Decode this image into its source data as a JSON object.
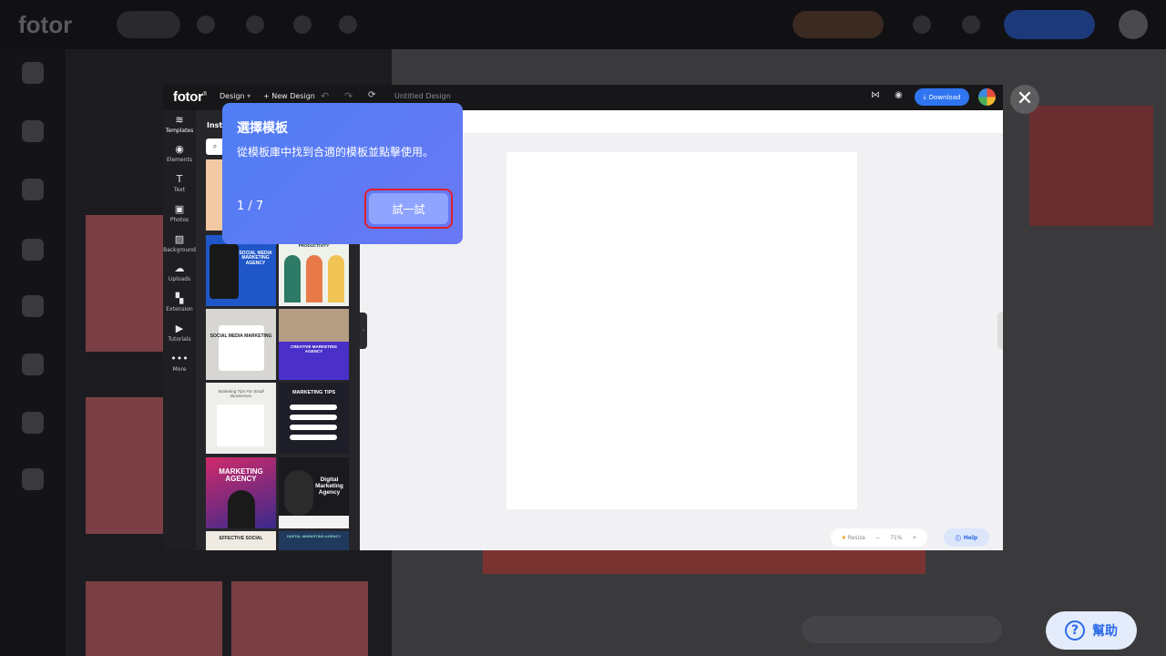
{
  "editor": {
    "logo": "fotor",
    "menu_design": "Design",
    "menu_new_design": "New Design",
    "doc_title": "Untitled Design",
    "download_label": "Download",
    "panel_title": "Insta",
    "rail": [
      {
        "label": "Templates",
        "icon": "layers-icon",
        "glyph": "≋"
      },
      {
        "label": "Elements",
        "icon": "elements-icon",
        "glyph": "◉"
      },
      {
        "label": "Text",
        "icon": "text-icon",
        "glyph": "T"
      },
      {
        "label": "Photos",
        "icon": "photo-icon",
        "glyph": "▣"
      },
      {
        "label": "Background",
        "icon": "background-icon",
        "glyph": "▨"
      },
      {
        "label": "Uploads",
        "icon": "upload-icon",
        "glyph": "☁"
      },
      {
        "label": "Extension",
        "icon": "extension-icon",
        "glyph": "▚"
      },
      {
        "label": "Tutorials",
        "icon": "tutorial-icon",
        "glyph": "▶"
      },
      {
        "label": "More",
        "icon": "more-icon",
        "glyph": "•••"
      }
    ],
    "templates": [
      {
        "text": "SOCIAL MEDIA MARKETING AGENCY"
      },
      {
        "text": "3 STEPS TO INCREASE YOUR PRODUCTIVITY"
      },
      {
        "text": "SOCIAL MEDIA MARKETING"
      },
      {
        "text": "CREATIVE MARKETING AGENCY"
      },
      {
        "text": "Marketing Tips For Small Businesses"
      },
      {
        "text": "MARKETING TIPS"
      },
      {
        "text": "MARKETING AGENCY"
      },
      {
        "text": "Digital Marketing Agency"
      },
      {
        "text": "EFFECTIVE SOCIAL"
      },
      {
        "text": "DIGITAL MARKETING AGENCY"
      }
    ],
    "zoom": {
      "resize_label": "Resize",
      "value": "71%"
    },
    "help_label": "Help"
  },
  "tooltip": {
    "title": "選擇模板",
    "body": "從模板庫中找到合適的模板並點擊使用。",
    "step": "1 / 7",
    "try_label": "試一試"
  },
  "help_fab": {
    "label": "幫助"
  },
  "colors": {
    "accent": "#2f74f0",
    "tooltip": "#5a7cf4",
    "highlight": "#e21d2b"
  }
}
